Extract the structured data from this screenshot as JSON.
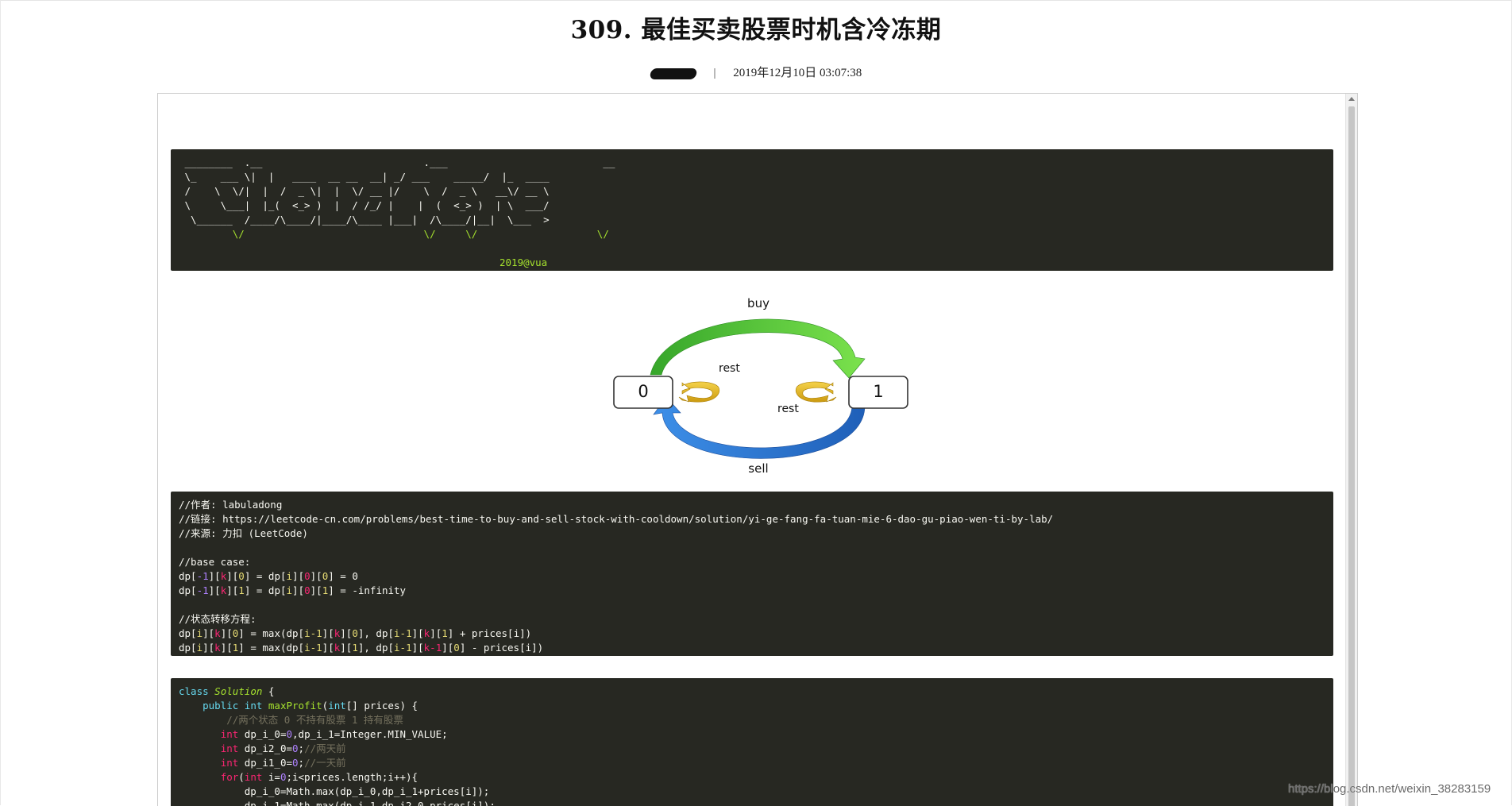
{
  "article": {
    "title": "309. 最佳买卖股票时机含冷冻期",
    "separator": "|",
    "date": "2019年12月10日 03:07:38"
  },
  "ascii_banner": {
    "lines": [
      " ________  .__                           .___                          __",
      " \\_    ___ \\|  |   ____  __ __  __| _/ ___    _____/  |_  ____",
      " /    \\  \\/|  |  /  _ \\|  |  \\/ __ |/    \\  /  _ \\   __\\/ __ \\",
      " \\     \\___|  |_(  <_> )  |  / /_/ |    |  (  <_> )  | \\  ___/",
      "  \\______  /____/\\____/|____/\\____ |___|  /\\____/|__|  \\___  >",
      "         \\/                              \\/     \\/                    \\/"
    ],
    "signature": "2019@vua"
  },
  "diagram": {
    "state_0": "0",
    "state_1": "1",
    "label_buy": "buy",
    "label_sell": "sell",
    "label_rest_0": "rest",
    "label_rest_1": "rest"
  },
  "note_block": {
    "author": "//作者: labuladong",
    "link": "//链接: https://leetcode-cn.com/problems/best-time-to-buy-and-sell-stock-with-cooldown/solution/yi-ge-fang-fa-tuan-mie-6-dao-gu-piao-wen-ti-by-lab/",
    "source": "//来源: 力扣 (LeetCode)",
    "base_case_comment": "//base case:",
    "transition_comment": "//状态转移方程:"
  },
  "code_block": {
    "comment_states": "//两个状态 0 不持有股票 1 持有股票",
    "comment_two_days": "//两天前",
    "comment_one_day": "//一天前"
  },
  "watermark": "https://blog.csdn.net/weixin_38283159",
  "colors": {
    "code_bg": "#272822",
    "buy_arrow": "#4ec62a",
    "sell_arrow": "#2e78d6",
    "rest_arrow": "#e8b81a"
  }
}
